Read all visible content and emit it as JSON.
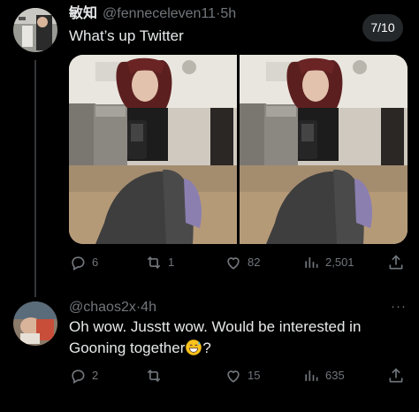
{
  "tweet1": {
    "display_name": "敏知",
    "handle": "@fenneceleven11",
    "dot": "·",
    "time": "5h",
    "text": "What’s up Twitter",
    "more": "···",
    "media_counter": "7/10",
    "actions": {
      "replies": "6",
      "retweets": "1",
      "likes": "82",
      "views": "2,501"
    }
  },
  "tweet2": {
    "handle": "@chaos2x",
    "dot": "·",
    "time": "4h",
    "text_line1": "Oh wow. Jusstt wow. Would be interested in",
    "text_line2": "Gooning together",
    "text_line2_end": "?",
    "more": "···",
    "actions": {
      "replies": "2",
      "retweets": "",
      "likes": "15",
      "views": "635"
    }
  },
  "colors": {
    "background": "#000000",
    "text": "#e7e9ea",
    "muted": "#71767b",
    "thread_line": "#333639"
  },
  "icons": [
    "reply-icon",
    "retweet-icon",
    "like-icon",
    "views-icon",
    "share-icon",
    "more-icon",
    "grinning-sweat-emoji"
  ]
}
